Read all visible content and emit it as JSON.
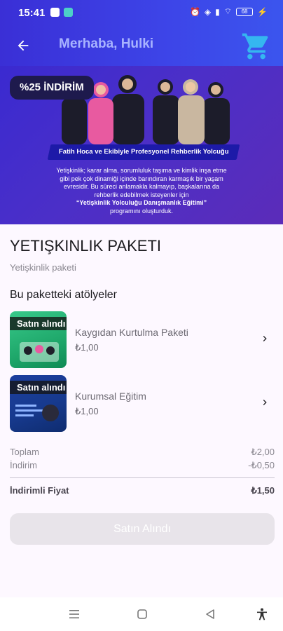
{
  "status": {
    "time": "15:41",
    "battery": "68"
  },
  "appbar": {
    "title": "Merhaba, Hulki"
  },
  "banner": {
    "badge": "%25 İNDİRİM",
    "ribbon": "Fatih Hoca ve Ekibiyle Profesyonel Rehberlik Yolcuğu",
    "text_lines": [
      "Yetişkinlik; karar alma, sorumluluk taşıma ve kimlik inşa etme",
      "gibi pek çok dinamiği içinde barındıran karmaşık bir yaşam",
      "evresidir. Bu süreci anlamakla kalmayıp, başkalarına da",
      "rehberlik edebilmek isteyenler için"
    ],
    "program": "“Yetişkinlik Yolculuğu Danışmanlık Eğitimi”",
    "program_suffix": "programını oluşturduk."
  },
  "package": {
    "title": "YETIŞKINLIK PAKETI",
    "subtitle": "Yetişkinlik paketi",
    "section_title": "Bu paketteki atölyeler"
  },
  "items": [
    {
      "tag": "Satın alındı",
      "name": "Kaygıdan Kurtulma Paketi",
      "price": "₺1,00"
    },
    {
      "tag": "Satın alındı",
      "name": "Kurumsal Eğitim",
      "price": "₺1,00"
    }
  ],
  "summary": {
    "total_label": "Toplam",
    "total_value": "₺2,00",
    "discount_label": "İndirim",
    "discount_value": "-₺0,50",
    "final_label": "İndirimli Fiyat",
    "final_value": "₺1,50"
  },
  "buy_button": "Satın Alındı",
  "colors": {
    "header": "#3d45e8",
    "cart": "#35b6f0",
    "title_muted": "#a8b3ff"
  }
}
